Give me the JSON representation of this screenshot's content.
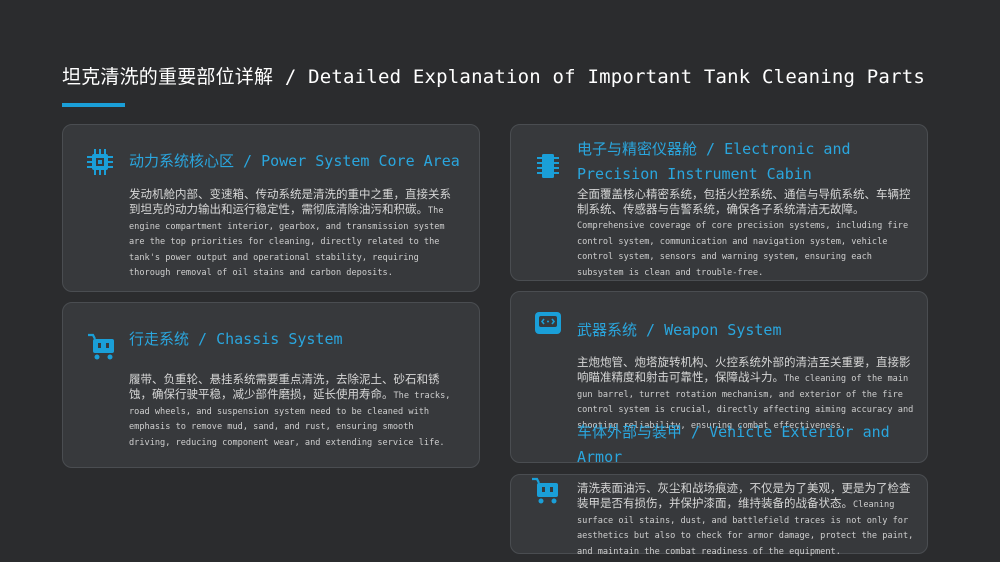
{
  "page": {
    "title": "坦克清洗的重要部位详解 / Detailed Explanation of Important Tank Cleaning Parts"
  },
  "colors": {
    "background": "#2b2c2e",
    "card": "#37393c",
    "accent": "#1a9fd8",
    "title_text": "#ffffff",
    "body_text": "#d6d6d6"
  },
  "cards": [
    {
      "icon": "cpu-chip-icon",
      "title": "动力系统核心区 / Power System Core Area",
      "body_cn": "发动机舱内部、变速箱、传动系统是清洗的重中之重，直接关系到坦克的动力输出和运行稳定性，需彻底清除油污和积碳。",
      "body_en": "The engine compartment interior, gearbox, and transmission system are the top priorities for cleaning, directly related to the tank's power output and operational stability, requiring thorough removal of oil stains and carbon deposits."
    },
    {
      "icon": "shopping-cart-icon",
      "title": "行走系统 / Chassis System",
      "body_cn": "履带、负重轮、悬挂系统需要重点清洗，去除泥土、砂石和锈蚀，确保行驶平稳，减少部件磨损，延长使用寿命。",
      "body_en": "The tracks, road wheels, and suspension system need to be cleaned with emphasis to remove mud, sand, and rust, ensuring smooth driving, reducing component wear, and extending service life."
    },
    {
      "icon": "memory-chip-icon",
      "title": "电子与精密仪器舱 / Electronic and Precision Instrument Cabin",
      "body_cn": "全面覆盖核心精密系统，包括火控系统、通信与导航系统、车辆控制系统、传感器与告警系统，确保各子系统清洁无故障。",
      "body_en": "Comprehensive coverage of core precision systems, including fire control system, communication and navigation system, vehicle control system, sensors and warning system, ensuring each subsystem is clean and trouble-free."
    },
    {
      "icon": "weapon-scanner-icon",
      "title": "武器系统 / Weapon System",
      "body_cn": "主炮炮管、炮塔旋转机构、火控系统外部的清洁至关重要，直接影响瞄准精度和射击可靠性，保障战斗力。",
      "body_en": "The cleaning of the main gun barrel, turret rotation mechanism, and exterior of the fire control system is crucial, directly affecting aiming accuracy and shooting reliability, ensuring combat effectiveness."
    },
    {
      "icon": "shopping-cart-icon",
      "title": "车体外部与装甲 / Vehicle Exterior and Armor",
      "body_cn": "清洗表面油污、灰尘和战场痕迹，不仅是为了美观，更是为了检查装甲是否有损伤，并保护漆面，维持装备的战备状态。",
      "body_en": "Cleaning surface oil stains, dust, and battlefield traces is not only for aesthetics but also to check for armor damage, protect the paint, and maintain the combat readiness of the equipment."
    }
  ]
}
